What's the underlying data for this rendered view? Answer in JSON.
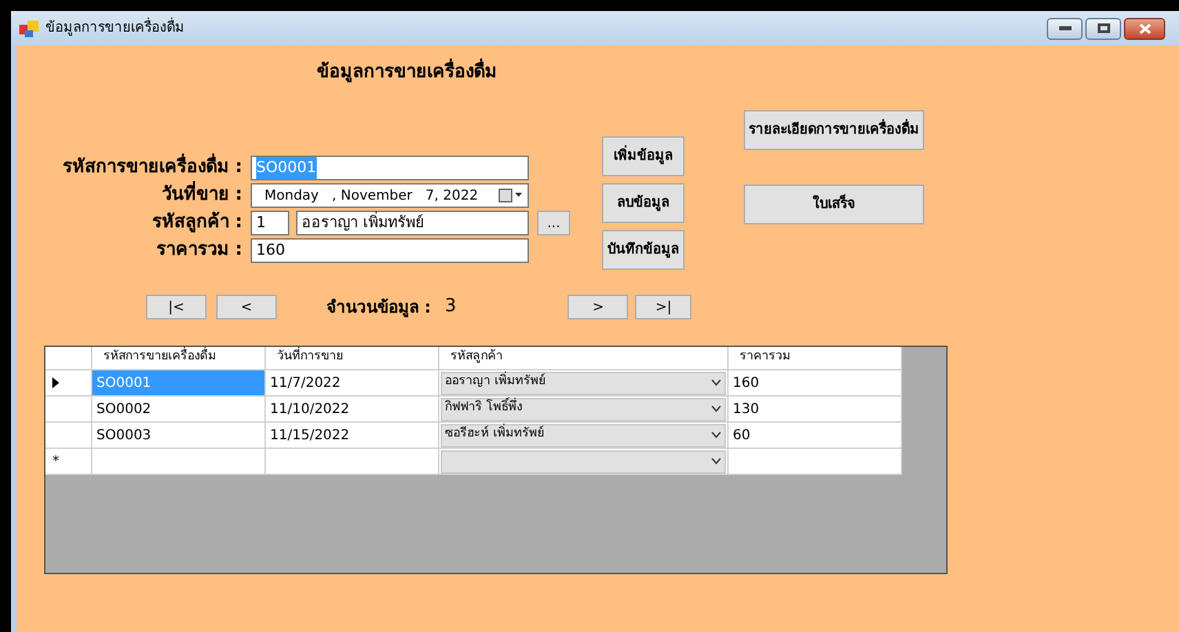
{
  "window": {
    "title": "ข้อมูลการขายเครื่องดื่ม"
  },
  "heading": "ข้อมูลการขายเครื่องดื่ม",
  "form": {
    "sale_id": {
      "label": "รหัสการขายเครื่องดื่ม :",
      "value": "SO0001",
      "text_selected": true
    },
    "date": {
      "label": "วันที่ขาย :",
      "value": "Monday   , November   7, 2022"
    },
    "customer": {
      "label": "รหัสลูกค้า :",
      "id": "1",
      "name": "ออราญา เพิ่มทรัพย์",
      "browse": "..."
    },
    "total": {
      "label": "ราคารวม :",
      "value": "160"
    }
  },
  "actions": [
    "เพิ่มข้อมูล",
    "ลบข้อมูล",
    "บันทึกข้อมูล"
  ],
  "side_actions": [
    "รายละเอียดการขายเครื่องดื่ม",
    "ใบเสร็จ"
  ],
  "navigation": {
    "first": "|<",
    "prev": "<",
    "count_label": "จำนวนข้อมูล :",
    "count": "3",
    "next": ">",
    "last": ">|"
  },
  "table": {
    "columns": [
      "รหัสการขายเครื่องดื่ม",
      "วันที่การขาย",
      "รหัสลูกค้า",
      "ราคารวม"
    ],
    "rows": [
      {
        "selected": true,
        "cells": [
          "SO0001",
          "11/7/2022",
          "ออราญา เพิ่มทรัพย์",
          "160"
        ]
      },
      {
        "selected": false,
        "cells": [
          "SO0002",
          "11/10/2022",
          "กิฟฟาริ โพธิ์พึ่ง",
          "130"
        ]
      },
      {
        "selected": false,
        "cells": [
          "SO0003",
          "11/15/2022",
          "ซอรีฮะห์ เพิ่มทรัพย์",
          "60"
        ]
      }
    ],
    "new_row_marker": "*"
  }
}
